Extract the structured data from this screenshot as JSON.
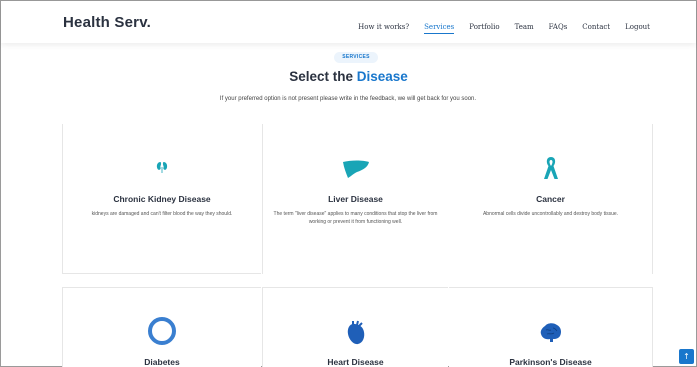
{
  "header": {
    "logo": "Health Serv.",
    "nav": [
      {
        "label": "How it works?",
        "active": false
      },
      {
        "label": "Services",
        "active": true
      },
      {
        "label": "Portfolio",
        "active": false
      },
      {
        "label": "Team",
        "active": false
      },
      {
        "label": "FAQs",
        "active": false
      },
      {
        "label": "Contact",
        "active": false
      },
      {
        "label": "Logout",
        "active": false
      }
    ]
  },
  "section": {
    "tag": "SERVICES",
    "heading_prefix": "Select the",
    "heading_accent": "Disease",
    "subtitle": "If your preferred option is not present please write in the feedback, we will get back for you soon."
  },
  "cards": [
    {
      "icon": "kidney-icon",
      "title": "Chronic Kidney Disease",
      "description": "kidneys are damaged and can't filter blood the way they should."
    },
    {
      "icon": "liver-icon",
      "title": "Liver Disease",
      "description": "The term \"liver disease\" applies to many conditions that stop the liver from working or prevent it from functioning well."
    },
    {
      "icon": "ribbon-icon",
      "title": "Cancer",
      "description": "Abnormal cells divide uncontrollably and destroy body tissue."
    },
    {
      "icon": "ring-icon",
      "title": "Diabetes",
      "description": ""
    },
    {
      "icon": "heart-icon",
      "title": "Heart Disease",
      "description": ""
    },
    {
      "icon": "brain-icon",
      "title": "Parkinson's Disease",
      "description": ""
    }
  ],
  "colors": {
    "accent": "#1977cc",
    "teal": "#19a5b6",
    "dark": "#2b3240"
  },
  "back_to_top": {
    "icon": "arrow-up-icon",
    "glyph": "↑"
  }
}
